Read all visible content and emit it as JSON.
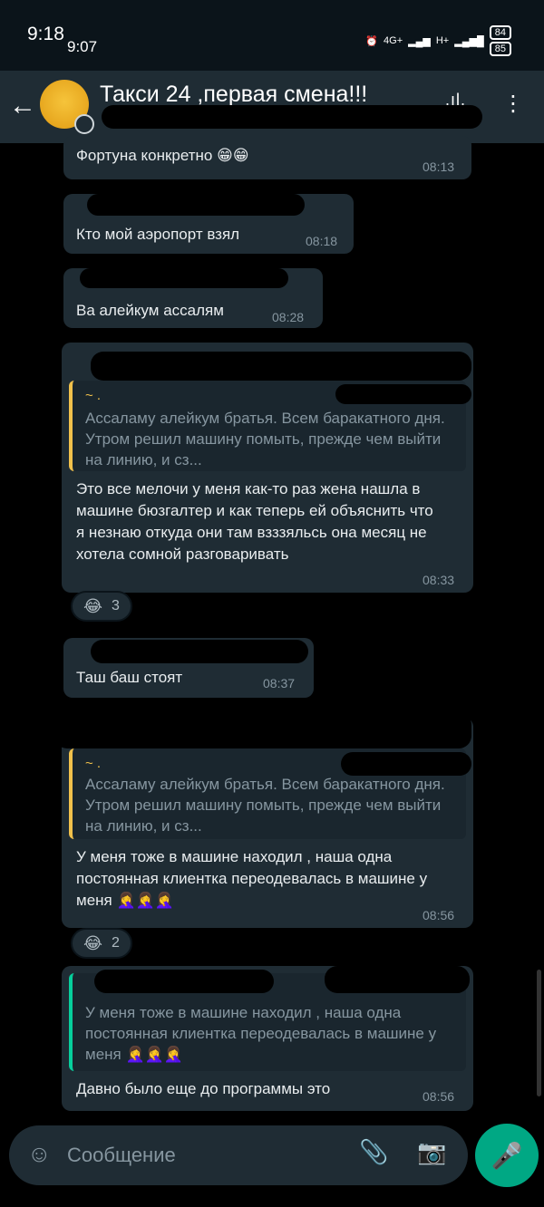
{
  "status": {
    "time": "9:18",
    "time2": "9:07",
    "network": "4G+",
    "network2": "H+",
    "battery1": "84",
    "battery2": "85"
  },
  "header": {
    "title": "Такси 24 ,первая смена!!!"
  },
  "messages": [
    {
      "text": "Фортуна конкретно 😁😁",
      "time": "08:13"
    },
    {
      "text": "Кто мой аэропорт взял",
      "time": "08:18",
      "name_prefix": "~"
    },
    {
      "text": "Ва алейкум ассалям",
      "time": "08:28",
      "name_prefix": "~"
    },
    {
      "name_prefix": "~",
      "quote_name": "~ .",
      "quote_text": "Ассаламу алейкум братья. Всем баракатного дня. Утром решил машину помыть, прежде чем выйти на линию, и сз...",
      "text": "Это все мелочи у меня как-то раз жена нашла в машине бюзгалтер и как теперь ей объяснить что я незнаю откуда они там взззяльсь она месяц не хотела сомной разговаривать",
      "time": "08:33",
      "reaction_emoji": "😂",
      "reaction_count": "3"
    },
    {
      "text": "Таш баш стоят",
      "time": "08:37",
      "name_prefix": "~"
    },
    {
      "quote_name": "~ .",
      "quote_text": "Ассаламу алейкум братья. Всем баракатного дня. Утром решил машину помыть, прежде чем выйти на линию, и сз...",
      "text": "У меня тоже в машине находил , наша одна постоянная клиентка переодевалась в машине у меня 🤦‍♀️🤦‍♀️🤦‍♀️",
      "time": "08:56",
      "reaction_emoji": "😂",
      "reaction_count": "2"
    },
    {
      "quote_text": "У меня тоже в машине находил , наша одна постоянная клиентка переодевалась в машине у меня 🤦‍♀️🤦‍♀️🤦‍♀️",
      "text": "Давно было еще до программы это",
      "time": "08:56"
    }
  ],
  "composer": {
    "placeholder": "Сообщение"
  },
  "icons": {
    "back": "arrow-left",
    "call": "voice-call",
    "more": "more-vertical",
    "emoji": "emoji",
    "attach": "paperclip",
    "camera": "camera",
    "mic": "microphone"
  },
  "colors": {
    "accent": "#00a884",
    "header": "#1f2c34",
    "bubble": "#1f2c34",
    "quote_yellow": "#f1c14b",
    "quote_teal": "#06cf9c"
  }
}
